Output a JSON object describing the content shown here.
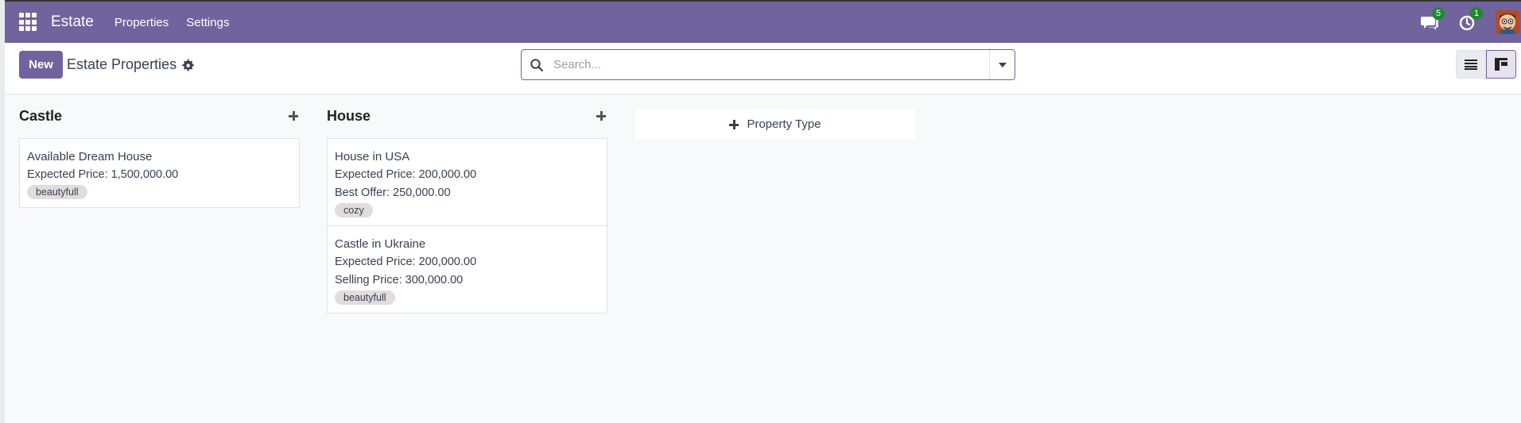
{
  "navbar": {
    "app_name": "Estate",
    "menus": [
      "Properties",
      "Settings"
    ],
    "messages_badge": "5",
    "activity_badge": "1",
    "background_color": "#71639e"
  },
  "control_panel": {
    "new_label": "New",
    "breadcrumb": "Estate Properties",
    "search_placeholder": "Search..."
  },
  "kanban": {
    "columns": [
      {
        "title": "Castle",
        "cards": [
          {
            "name": "Available Dream House",
            "lines": [
              "Expected Price: 1,500,000.00"
            ],
            "tag": "beautyfull"
          }
        ]
      },
      {
        "title": "House",
        "cards": [
          {
            "name": "House in USA",
            "lines": [
              "Expected Price: 200,000.00",
              "Best Offer: 250,000.00"
            ],
            "tag": "cozy"
          },
          {
            "name": "Castle in Ukraine",
            "lines": [
              "Expected Price: 200,000.00",
              "Selling Price: 300,000.00"
            ],
            "tag": "beautyfull"
          }
        ]
      }
    ],
    "add_column_label": "Property Type"
  }
}
